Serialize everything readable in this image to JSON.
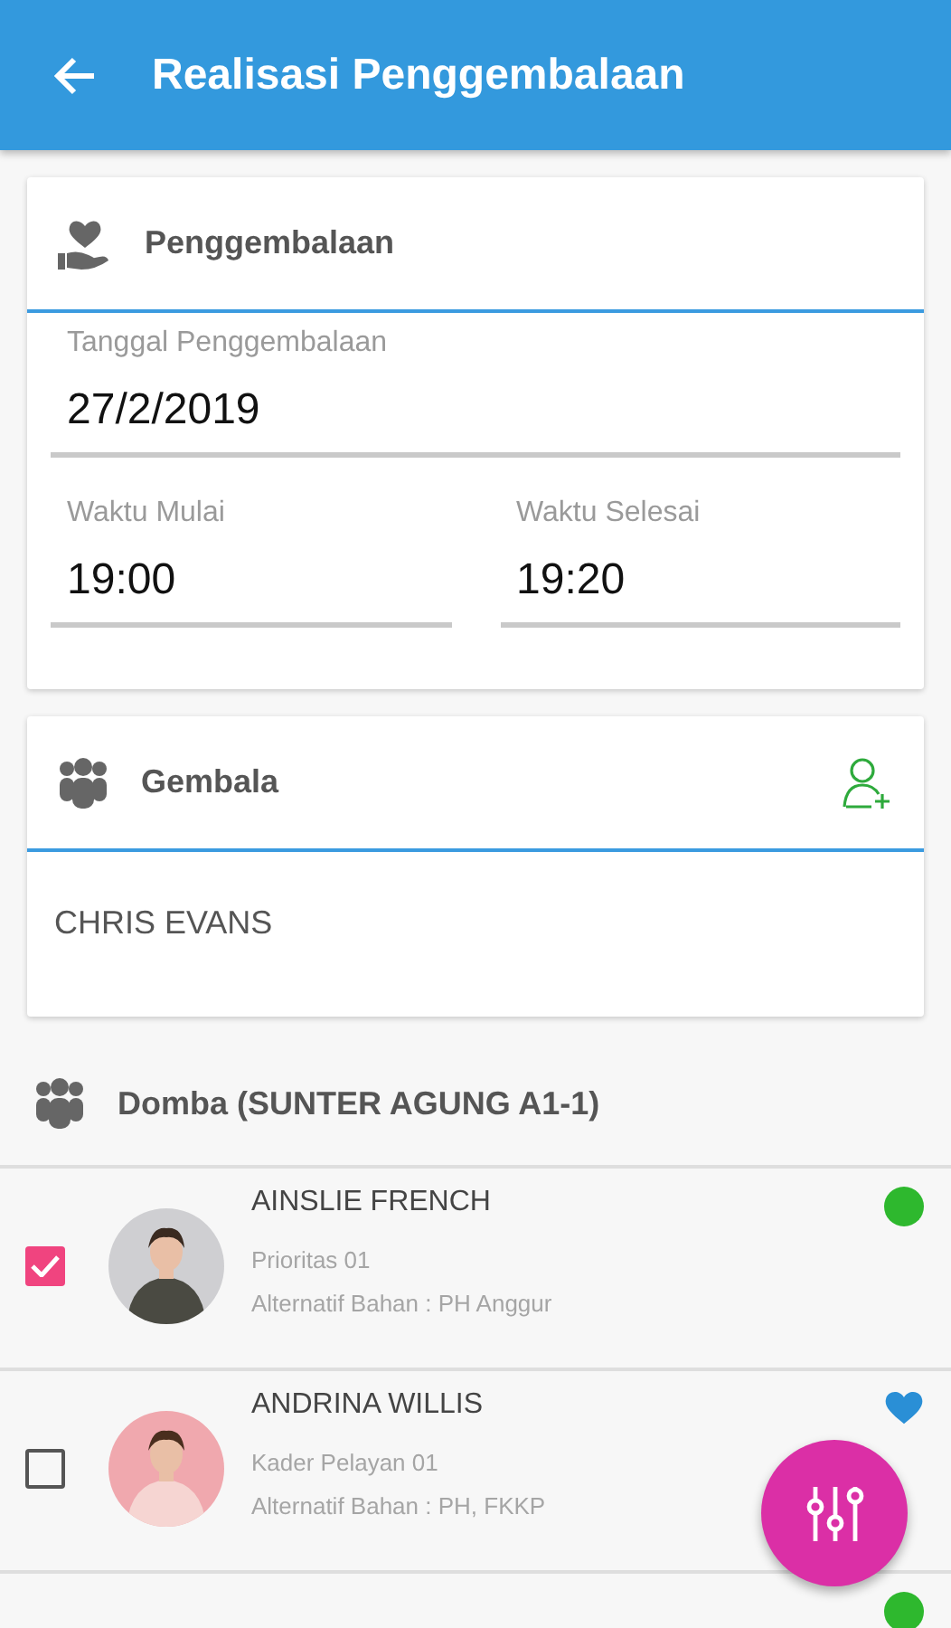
{
  "app_bar": {
    "title": "Realisasi Penggembalaan"
  },
  "schedule_card": {
    "title": "Penggembalaan",
    "date": {
      "label": "Tanggal Penggembalaan",
      "value": "27/2/2019"
    },
    "times": [
      {
        "label": "Waktu Mulai",
        "value": "19:00"
      },
      {
        "label": "Waktu Selesai",
        "value": "19:20"
      }
    ]
  },
  "shepherd_card": {
    "title": "Gembala",
    "name": "CHRIS EVANS"
  },
  "sheep_section": {
    "title": "Domba (SUNTER AGUNG A1-1)"
  },
  "members": [
    {
      "name": "AINSLIE FRENCH",
      "role": "Prioritas 01",
      "material": "Alternatif Bahan : PH Anggur",
      "checked": true,
      "kind": "dot",
      "color": "#2eb82e"
    },
    {
      "name": "ANDRINA WILLIS",
      "role": "Kader Pelayan 01",
      "material": "Alternatif Bahan : PH, FKKP",
      "checked": false,
      "kind": "heart",
      "color": "#2a8fd6"
    },
    {
      "kind": "dot",
      "color": "#2eb82e"
    }
  ]
}
